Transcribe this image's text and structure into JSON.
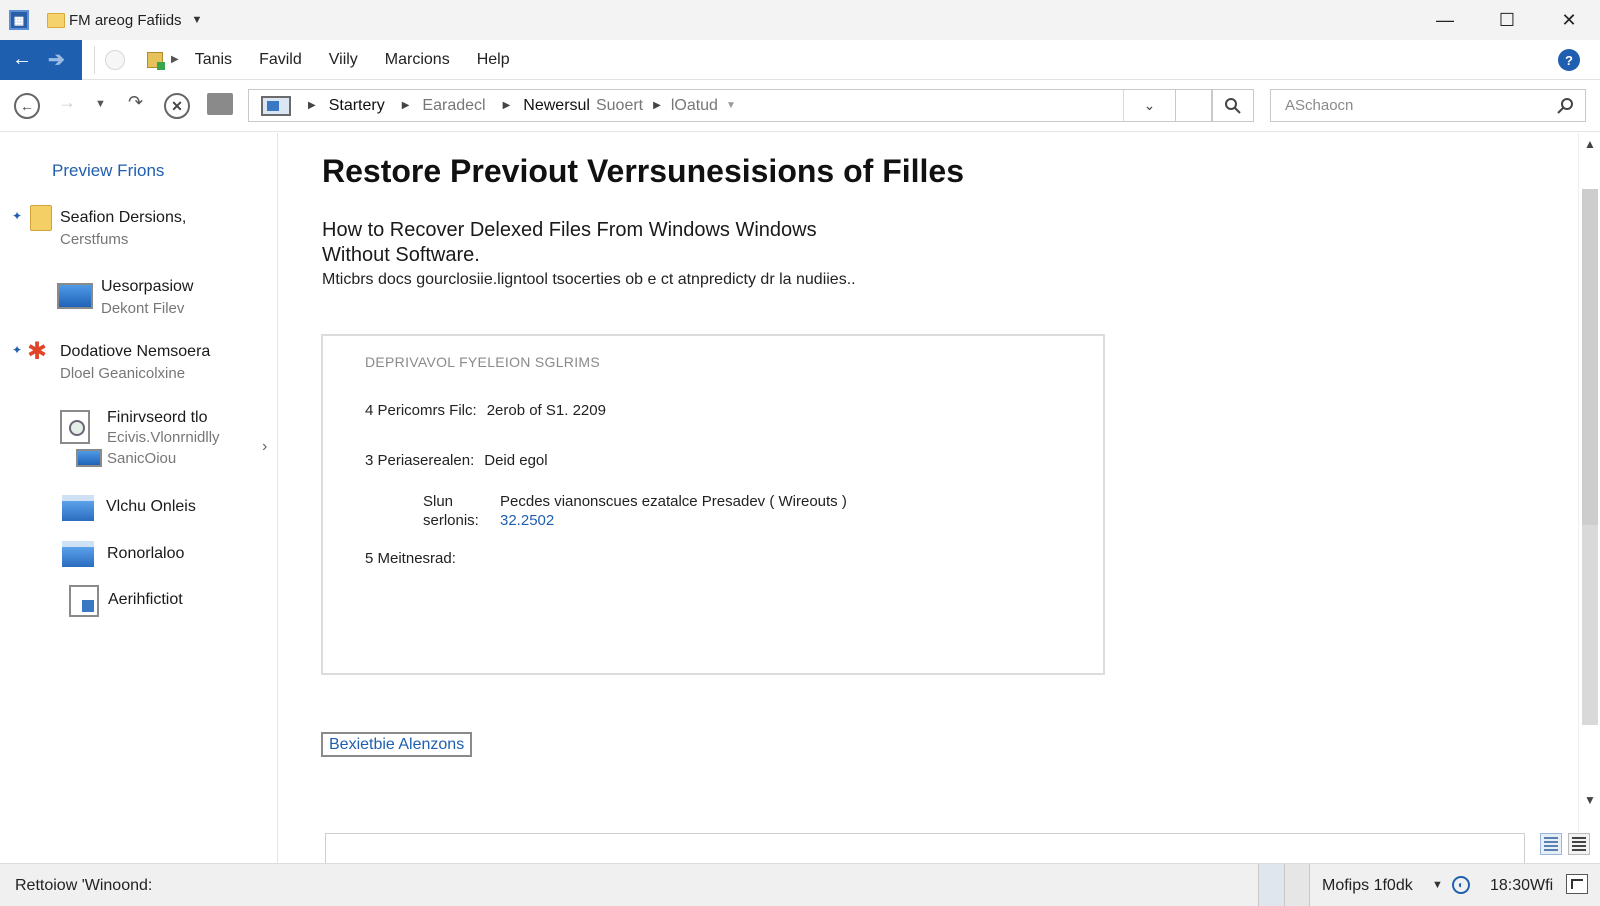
{
  "window": {
    "title": "FM areog Fafiids",
    "controls": {
      "minimize": "—",
      "maximize": "☐",
      "close": "✕"
    }
  },
  "menubar": {
    "items": [
      "Tanis",
      "Favild",
      "Viily",
      "Marcions",
      "Help"
    ],
    "help_glyph": "?"
  },
  "address": {
    "crumbs": [
      "Startery",
      "Earadecl",
      "Newersul",
      "Suoert",
      "lOatud"
    ],
    "search": {
      "placeholder": "ASchaocn"
    }
  },
  "sidebar": {
    "heading": "Preview Frions",
    "items": [
      {
        "label": "Seafion Dersions,",
        "sublabel": "Cerstfums",
        "icon": "folder-icon"
      },
      {
        "label": "Uesorpasiow",
        "sublabel": "Dekont Filev",
        "icon": "monitor-icon"
      },
      {
        "label": "Dodatiove Nemsoera",
        "sublabel": "Dloel Geanicolxine",
        "icon": "star-icon"
      },
      {
        "label": "Finirvseord tlo",
        "sublabel": "Ecivis.Vlonrnidlly",
        "sublabel2": "SanicOiou",
        "icon": "file-icon"
      },
      {
        "label": "Vlchu Onleis",
        "icon": "drive-icon"
      },
      {
        "label": "Ronorlaloo",
        "icon": "drive-icon"
      },
      {
        "label": "Aerihfictiot",
        "icon": "document-icon"
      }
    ]
  },
  "main": {
    "title": "Restore Previout Verrsunesisions of Filles",
    "subheading": "How to Recover Delexed Files From Windows Windows Without Software.",
    "description": "Mticbrs docs gourclosiie.ligntool tsocerties ob e ct atnpredicty dr la nudiies..",
    "panel": {
      "header": "DEPRIVAVOL FYELEION SGLRIMS",
      "rows": [
        {
          "label": "4 Pericomrs Filc:",
          "value": "2erob of S1. 2209"
        },
        {
          "label": "3 Periaserealen:",
          "value": "Deid egol"
        }
      ],
      "sub_label_1": "Slun",
      "sub_label_2": "serlonis:",
      "sub_text": "Pecdes vianonscues ezatalce Presadev ( Wireouts )",
      "sub_value": "32.2502",
      "row5_label": "5 Meitnesrad:"
    },
    "restore_button": "Bexietbie Alenzons"
  },
  "statusbar": {
    "left": "Rettoiow 'Winoond:",
    "zoom": "Mofips 1f0dk",
    "time": "18:30Wfi"
  },
  "colors": {
    "accent": "#1f5fb0",
    "title_bar": "#f3f3f3",
    "status_bar": "#f0f0f0",
    "star": "#e0452a",
    "folder": "#f3cf66"
  }
}
